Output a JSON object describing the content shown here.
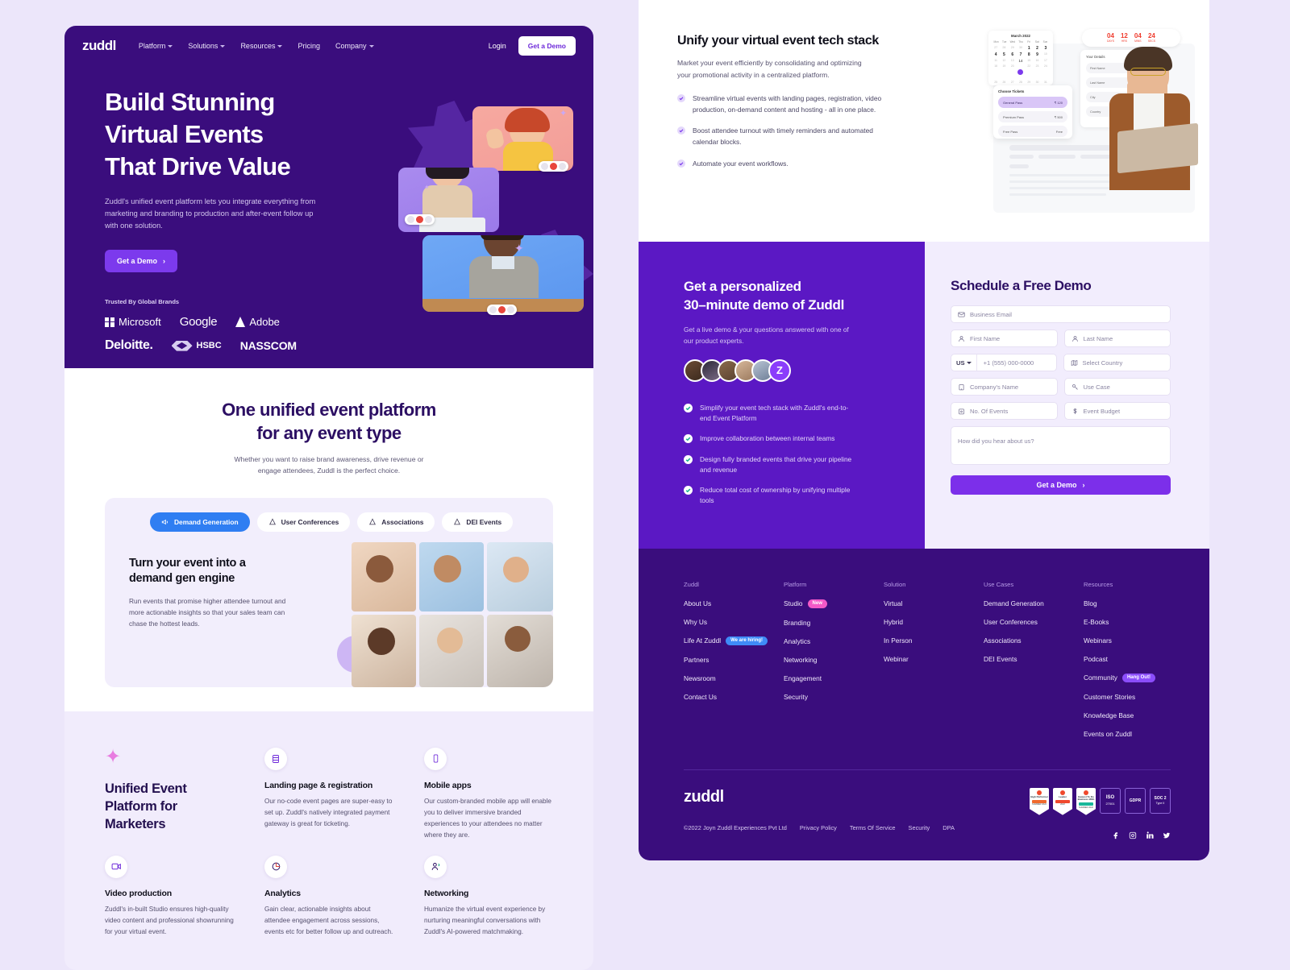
{
  "brand": {
    "name": "zuddl",
    "accent": "#7c3aed",
    "deep_purple": "#3a0d7d",
    "mid_purple": "#5b18c4"
  },
  "nav": {
    "logo": "zuddl",
    "links": [
      {
        "label": "Platform",
        "caret": true
      },
      {
        "label": "Solutions",
        "caret": true
      },
      {
        "label": "Resources",
        "caret": true
      },
      {
        "label": "Pricing",
        "caret": false
      },
      {
        "label": "Company",
        "caret": true
      }
    ],
    "login": "Login",
    "cta": "Get a Demo"
  },
  "hero": {
    "title_line1": "Build Stunning",
    "title_line2": "Virtual Events",
    "title_line3": "That Drive Value",
    "subtitle": "Zuddl's unified event platform lets you integrate everything from marketing and branding to production and after-event follow up with one solution.",
    "cta": "Get a Demo",
    "cta_arrow": "›",
    "trusted_label": "Trusted By Global Brands",
    "brands_row1": [
      "Microsoft",
      "Google",
      "Adobe"
    ],
    "brands_row2": [
      "Deloitte.",
      "HSBC",
      "NASSCOM"
    ]
  },
  "unified": {
    "heading_line1": "One unified event platform",
    "heading_line2": "for any event type",
    "subtitle_line1": "Whether you want to raise brand awareness, drive revenue or",
    "subtitle_line2": "engage attendees, Zuddl is the perfect choice.",
    "tabs": [
      {
        "label": "Demand Generation",
        "icon": "megaphone-icon",
        "active": true
      },
      {
        "label": "User Conferences",
        "icon": "conference-icon",
        "active": false
      },
      {
        "label": "Associations",
        "icon": "association-icon",
        "active": false
      },
      {
        "label": "DEI Events",
        "icon": "dei-icon",
        "active": false
      }
    ],
    "card": {
      "title_line1": "Turn your event into a",
      "title_line2": "demand gen engine",
      "body": "Run events that promise higher attendee turnout and more actionable insights so that your sales team can chase the hottest leads."
    }
  },
  "features": {
    "title_line1": "Unified Event",
    "title_line2": "Platform for",
    "title_line3": "Marketers",
    "sparkle": "✦",
    "items": [
      {
        "icon": "ticket-icon",
        "title": "Landing page & registration",
        "body": "Our no-code event pages are super-easy to set up. Zuddl's natively integrated payment gateway is great for ticketing."
      },
      {
        "icon": "mobile-icon",
        "title": "Mobile apps",
        "body": "Our custom-branded mobile app will enable you to deliver immersive branded experiences to your attendees no matter where they are."
      },
      {
        "icon": "video-icon",
        "title": "Video production",
        "body": "Zuddl's in-built Studio ensures high-quality video content and professional showrunning for your virtual event."
      },
      {
        "icon": "analytics-icon",
        "title": "Analytics",
        "body": "Gain clear, actionable insights about attendee engagement across sessions, events etc for better follow up and outreach."
      },
      {
        "icon": "networking-icon",
        "title": "Networking",
        "body": "Humanize the virtual event experience by nurturing meaningful conversations with Zuddl's AI-powered matchmaking."
      }
    ]
  },
  "unify": {
    "heading": "Unify your virtual event tech stack",
    "lead": "Market your event efficiently by consolidating and optimizing your promotional activity in a centralized platform.",
    "bullets": [
      "Streamline virtual events with landing pages, registration, video production, on-demand content and hosting - all in one place.",
      "Boost attendee turnout with timely reminders and automated calendar blocks.",
      "Automate your event workflows."
    ],
    "art": {
      "calendar_month": "March 2022",
      "weekdays": [
        "Mon",
        "Tue",
        "Wed",
        "Thu",
        "Fri",
        "Sat",
        "Sun"
      ],
      "countdown": [
        {
          "value": "04",
          "label": "DAYS"
        },
        {
          "value": "12",
          "label": "HRS"
        },
        {
          "value": "04",
          "label": "MINS"
        },
        {
          "value": "24",
          "label": "SECS"
        }
      ],
      "tickets_title": "Choose Tickets",
      "tickets": [
        {
          "name": "General Pass",
          "price": "₹ 120"
        },
        {
          "name": "Premium Pass",
          "price": "₹ 500"
        },
        {
          "name": "Free Pass",
          "price": "Free"
        }
      ],
      "details_title": "Your Details",
      "detail_fields": [
        "First Name",
        "Last Name",
        "City",
        "Country"
      ]
    }
  },
  "demo": {
    "heading_line1": "Get a personalized",
    "heading_line2": "30–minute demo of Zuddl",
    "lead": "Get a live demo & your questions answered with one of our product experts.",
    "avatar_badge": "Z",
    "bullets": [
      "Simplify your event tech stack with Zuddl's end-to-end Event Platform",
      " Improve collaboration between internal teams",
      "Design fully branded events that drive your pipeline and revenue",
      "Reduce total cost of ownership by unifying multiple tools"
    ]
  },
  "form": {
    "heading": "Schedule a Free Demo",
    "email_placeholder": "Business Email",
    "first_name_placeholder": "First Name",
    "last_name_placeholder": "Last Name",
    "country_code": "US",
    "phone_placeholder": "+1 (555) 000-0000",
    "select_country_placeholder": "Select Country",
    "company_placeholder": "Company's Name",
    "use_case_placeholder": "Use Case",
    "num_events_placeholder": "No. Of Events",
    "budget_placeholder": "Event Budget",
    "hear_placeholder": "How did you hear about us?",
    "submit": "Get a Demo",
    "submit_arrow": "›"
  },
  "footer": {
    "columns": [
      {
        "head": "Zuddl",
        "links": [
          {
            "label": "About Us"
          },
          {
            "label": "Why Us"
          },
          {
            "label": "Life At Zuddl",
            "pill": "We are hiring!",
            "pill_kind": "hiring"
          },
          {
            "label": "Partners"
          },
          {
            "label": "Newsroom"
          },
          {
            "label": "Contact Us"
          }
        ]
      },
      {
        "head": "Platform",
        "links": [
          {
            "label": "Studio",
            "pill": "New",
            "pill_kind": "new"
          },
          {
            "label": "Branding"
          },
          {
            "label": "Analytics"
          },
          {
            "label": "Networking"
          },
          {
            "label": "Engagement"
          },
          {
            "label": "Security"
          }
        ]
      },
      {
        "head": "Solution",
        "links": [
          {
            "label": "Virtual"
          },
          {
            "label": "Hybrid"
          },
          {
            "label": "In Person"
          },
          {
            "label": "Webinar"
          }
        ]
      },
      {
        "head": "Use Cases",
        "links": [
          {
            "label": "Demand Generation"
          },
          {
            "label": "User Conferences"
          },
          {
            "label": "Associations"
          },
          {
            "label": "DEI Events"
          }
        ]
      },
      {
        "head": "Resources",
        "links": [
          {
            "label": "Blog"
          },
          {
            "label": "E-Books"
          },
          {
            "label": "Webinars"
          },
          {
            "label": "Podcast"
          },
          {
            "label": "Community",
            "pill": "Hang Out!",
            "pill_kind": "hang"
          },
          {
            "label": "Customer Stories"
          },
          {
            "label": "Knowledge Base"
          },
          {
            "label": "Events on Zuddl"
          }
        ]
      }
    ],
    "logo": "zuddl",
    "copyright": "©2022 Joyn Zuddl Experiences Pvt Ltd",
    "legal": [
      "Privacy Policy",
      "Terms Of Service",
      "Security",
      "DPA"
    ],
    "badges": [
      {
        "type": "g2",
        "line1": "High Performer",
        "band": "#ef6a2d",
        "band_text": "Engage",
        "line2": "SUMMER 2022"
      },
      {
        "type": "g2",
        "line1": "Leader",
        "band": "#ef492d",
        "band_text": "EUROPE",
        "line2": "2022"
      },
      {
        "type": "g2",
        "line1": "Easiest To Do Business With",
        "band": "#19b79a",
        "band_text": "Financial",
        "line2": "SUMMER 2022"
      },
      {
        "type": "box",
        "line1": "ISO",
        "line2": "27001"
      },
      {
        "type": "box",
        "line1": "GDPR",
        "line2": ""
      },
      {
        "type": "box",
        "line1": "SOC 2",
        "line2": "Type II"
      }
    ],
    "socials": [
      "facebook-icon",
      "instagram-icon",
      "linkedin-icon",
      "twitter-icon"
    ]
  }
}
